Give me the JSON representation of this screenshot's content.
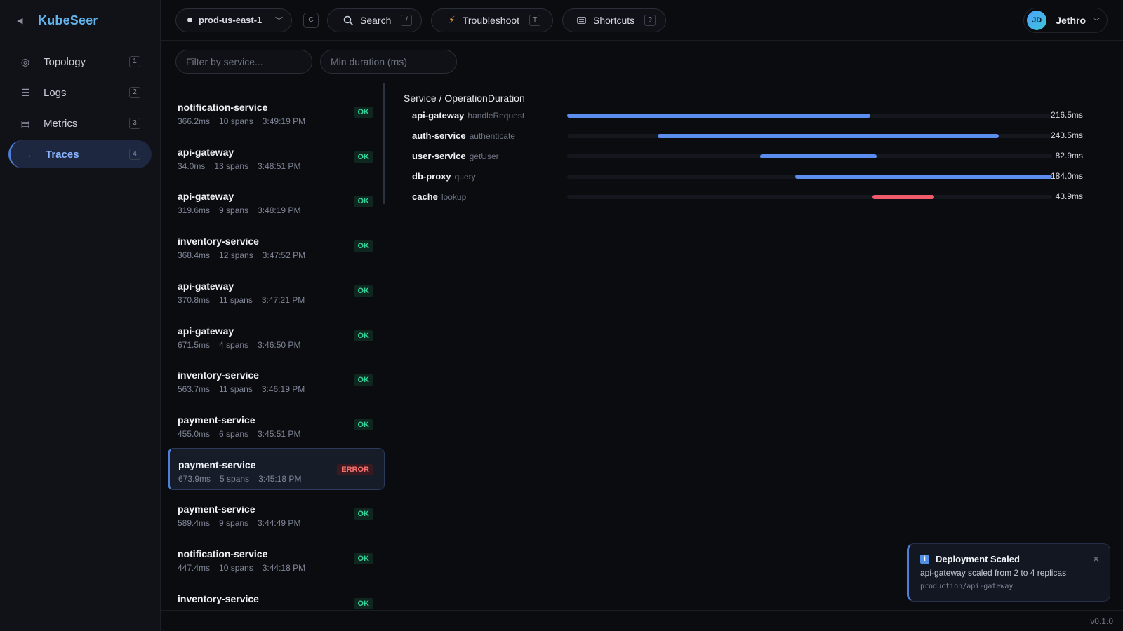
{
  "app": {
    "name": "KubeSeer",
    "version": "v0.1.0"
  },
  "sidebar": {
    "collapse_icon": "chevron-left-icon",
    "items": [
      {
        "label": "Topology",
        "key": "1",
        "icon": "topology-icon",
        "active": false
      },
      {
        "label": "Logs",
        "key": "2",
        "icon": "logs-icon",
        "active": false
      },
      {
        "label": "Metrics",
        "key": "3",
        "icon": "metrics-icon",
        "active": false
      },
      {
        "label": "Traces",
        "key": "4",
        "icon": "traces-icon",
        "active": true
      }
    ]
  },
  "topbar": {
    "cluster": "prod-us-east-1",
    "cluster_key": "C",
    "search": {
      "label": "Search",
      "key": "/"
    },
    "troubleshoot": {
      "label": "Troubleshoot",
      "key": "T"
    },
    "shortcuts": {
      "label": "Shortcuts",
      "key": "?"
    },
    "user": {
      "initials": "JD",
      "name": "Jethro"
    }
  },
  "filters": {
    "service_placeholder": "Filter by service...",
    "duration_placeholder": "Min duration (ms)"
  },
  "traces": [
    {
      "service": "notification-service",
      "duration": "366.2ms",
      "spans": "10 spans",
      "time": "3:49:19 PM",
      "status": "OK"
    },
    {
      "service": "api-gateway",
      "duration": "34.0ms",
      "spans": "13 spans",
      "time": "3:48:51 PM",
      "status": "OK"
    },
    {
      "service": "api-gateway",
      "duration": "319.6ms",
      "spans": "9 spans",
      "time": "3:48:19 PM",
      "status": "OK"
    },
    {
      "service": "inventory-service",
      "duration": "368.4ms",
      "spans": "12 spans",
      "time": "3:47:52 PM",
      "status": "OK"
    },
    {
      "service": "api-gateway",
      "duration": "370.8ms",
      "spans": "11 spans",
      "time": "3:47:21 PM",
      "status": "OK"
    },
    {
      "service": "api-gateway",
      "duration": "671.5ms",
      "spans": "4 spans",
      "time": "3:46:50 PM",
      "status": "OK"
    },
    {
      "service": "inventory-service",
      "duration": "563.7ms",
      "spans": "11 spans",
      "time": "3:46:19 PM",
      "status": "OK"
    },
    {
      "service": "payment-service",
      "duration": "455.0ms",
      "spans": "6 spans",
      "time": "3:45:51 PM",
      "status": "OK"
    },
    {
      "service": "payment-service",
      "duration": "673.9ms",
      "spans": "5 spans",
      "time": "3:45:18 PM",
      "status": "ERROR",
      "selected": true
    },
    {
      "service": "payment-service",
      "duration": "589.4ms",
      "spans": "9 spans",
      "time": "3:44:49 PM",
      "status": "OK"
    },
    {
      "service": "notification-service",
      "duration": "447.4ms",
      "spans": "10 spans",
      "time": "3:44:18 PM",
      "status": "OK"
    },
    {
      "service": "inventory-service",
      "duration": "",
      "spans": "",
      "time": "",
      "status": "OK"
    }
  ],
  "waterfall": {
    "header": "Service / OperationDuration",
    "spans": [
      {
        "service": "api-gateway",
        "operation": "handleRequest",
        "duration": "216.5ms",
        "start": 0.0,
        "end": 0.625,
        "error": false
      },
      {
        "service": "auth-service",
        "operation": "authenticate",
        "duration": "243.5ms",
        "start": 0.187,
        "end": 0.89,
        "error": false
      },
      {
        "service": "user-service",
        "operation": "getUser",
        "duration": "82.9ms",
        "start": 0.398,
        "end": 0.638,
        "error": false
      },
      {
        "service": "db-proxy",
        "operation": "query",
        "duration": "184.0ms",
        "start": 0.47,
        "end": 1.0,
        "error": false
      },
      {
        "service": "cache",
        "operation": "lookup",
        "duration": "43.9ms",
        "start": 0.63,
        "end": 0.757,
        "error": true
      }
    ]
  },
  "toast": {
    "title": "Deployment Scaled",
    "body": "api-gateway scaled from 2 to 4 replicas",
    "path": "production/api-gateway",
    "icon": "info-icon"
  },
  "colors": {
    "accent": "#63b3ed",
    "span": "#5b8def",
    "error_span": "#ef5b6a",
    "ok": "#34d399",
    "error": "#f87171"
  }
}
